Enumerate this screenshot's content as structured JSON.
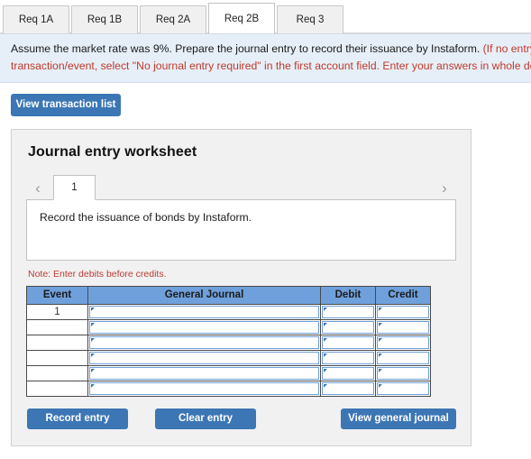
{
  "tabs": [
    {
      "label": "Req 1A",
      "active": false
    },
    {
      "label": "Req 1B",
      "active": false
    },
    {
      "label": "Req 2A",
      "active": false
    },
    {
      "label": "Req 2B",
      "active": true
    },
    {
      "label": "Req 3",
      "active": false
    }
  ],
  "banner": {
    "line1_main": "Assume the market rate was 9%. Prepare the journal entry to record their issuance by Instaform. ",
    "line1_red": "(If no entry",
    "line2_red": "transaction/event, select \"No journal entry required\" in the first account field. Enter your answers in whole do"
  },
  "toolbar": {
    "view_transaction_list": "View transaction list"
  },
  "worksheet": {
    "title": "Journal entry worksheet",
    "prev_arrow": "‹",
    "next_arrow": "›",
    "page_label": "1",
    "description": "Record the issuance of bonds by Instaform.",
    "note": "Note: Enter debits before credits.",
    "table": {
      "headers": [
        "Event",
        "General Journal",
        "Debit",
        "Credit"
      ],
      "rows": [
        {
          "event": "1",
          "general_journal": "",
          "debit": "",
          "credit": ""
        },
        {
          "event": "",
          "general_journal": "",
          "debit": "",
          "credit": ""
        },
        {
          "event": "",
          "general_journal": "",
          "debit": "",
          "credit": ""
        },
        {
          "event": "",
          "general_journal": "",
          "debit": "",
          "credit": ""
        },
        {
          "event": "",
          "general_journal": "",
          "debit": "",
          "credit": ""
        },
        {
          "event": "",
          "general_journal": "",
          "debit": "",
          "credit": ""
        }
      ]
    },
    "buttons": {
      "record_entry": "Record entry",
      "clear_entry": "Clear entry",
      "view_general_journal": "View general journal"
    }
  },
  "colors": {
    "primary_blue": "#3c76b5",
    "header_blue": "#6fa0dc",
    "banner_bg": "#e6eff8",
    "note_red": "#bd3b34",
    "panel_bg": "#f1f1f1"
  }
}
